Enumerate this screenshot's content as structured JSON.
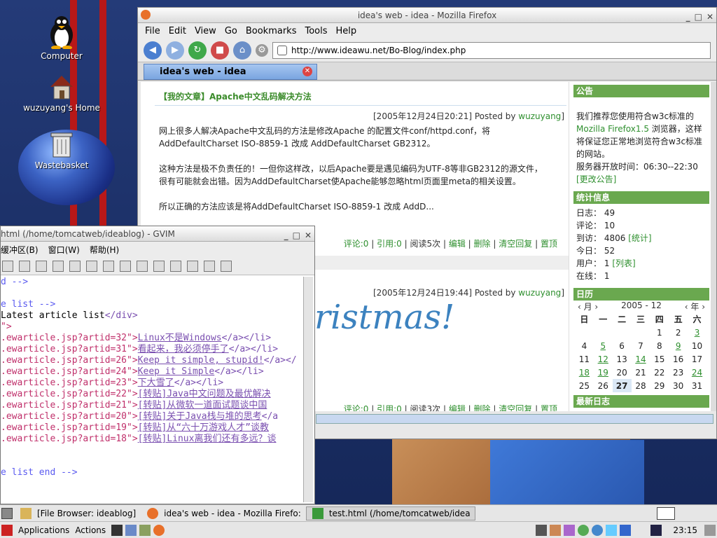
{
  "desktop": {
    "icons": [
      {
        "label": "Computer"
      },
      {
        "label": "wuzuyang's Home"
      },
      {
        "label": "Wastebasket"
      }
    ]
  },
  "firefox": {
    "title": "idea's web - idea - Mozilla Firefox",
    "menus": [
      "File",
      "Edit",
      "View",
      "Go",
      "Bookmarks",
      "Tools",
      "Help"
    ],
    "url": "http://www.ideawu.net/Bo-Blog/index.php",
    "tab_title": "idea's web - idea",
    "article1": {
      "title": "【我的文章】Apache中文乱码解决方法",
      "meta_prefix": "[2005年12月24日20:21]  Posted by ",
      "author": "wuzuyang",
      "meta_suffix": "]",
      "body": [
        "网上很多人解决Apache中文乱码的方法是修改Apache 的配置文件conf/httpd.conf，将",
        "AddDefaultCharset ISO-8859-1 改成 AddDefaultCharset GB2312。",
        "",
        "这种方法是极不负责任的！一但你这样改，以后Apache要是遇见编码为UTF-8等非GB2312的源文件，",
        "很有可能就会出错。因为AddDefaultCharset使Apache能够忽略html页面里meta的相关设置。",
        "",
        "所以正确的方法应该是将AddDefaultCharset ISO-8859-1 改成 AddD..."
      ],
      "footer": {
        "comments": "评论:0",
        "refs": "引用:0",
        "reads": "阅读5次",
        "edit": "编辑",
        "delete": "删除",
        "clear": "清空回复",
        "top": "置顶"
      }
    },
    "article2": {
      "meta_prefix": "[2005年12月24日19:44]  Posted by ",
      "author": "wuzuyang",
      "meta_suffix": "]",
      "image_text": "ristmas!",
      "footer": {
        "comments": "评论:0",
        "refs": "引用:0",
        "reads": "阅读3次",
        "edit": "编辑",
        "delete": "删除",
        "clear": "清空回复",
        "top": "置顶"
      }
    },
    "sidebar": {
      "notice_head": "公告",
      "notice_lines": [
        "我们推荐您使用符合w3c标准的",
        "Mozilla Firefox1.5",
        " 浏览器，这样",
        "将保证您正常地浏览符合w3c标准",
        "的网站。",
        "服务器开放时间：06:30--22:30",
        "[更改公告]"
      ],
      "stats_head": "统计信息",
      "stats": [
        {
          "k": "日志：",
          "v": "49",
          "link": ""
        },
        {
          "k": "评论：",
          "v": "10",
          "link": ""
        },
        {
          "k": "到访：",
          "v": "4806",
          "link": "[统计]"
        },
        {
          "k": "今日：",
          "v": "52",
          "link": ""
        },
        {
          "k": "用户：",
          "v": "1",
          "link": "[列表]"
        },
        {
          "k": "在线：",
          "v": "1",
          "link": ""
        }
      ],
      "cal_head": "日历",
      "cal_prev": "‹ 月 ›",
      "cal_month": "2005 - 12",
      "cal_year": "‹ 年 ›",
      "cal_days": [
        "日",
        "一",
        "二",
        "三",
        "四",
        "五",
        "六"
      ],
      "cal_rows": [
        [
          "",
          "",
          "",
          "",
          "1",
          "2",
          "3"
        ],
        [
          "4",
          "5",
          "6",
          "7",
          "8",
          "9",
          "10"
        ],
        [
          "11",
          "12",
          "13",
          "14",
          "15",
          "16",
          "17"
        ],
        [
          "18",
          "19",
          "20",
          "21",
          "22",
          "23",
          "24"
        ],
        [
          "25",
          "26",
          "27",
          "28",
          "29",
          "30",
          "31"
        ]
      ],
      "cal_links": [
        "3",
        "5",
        "9",
        "12",
        "14",
        "18",
        "19",
        "24"
      ],
      "cal_today": "27",
      "recent_head": "最新日志"
    }
  },
  "gvim": {
    "title": "html (/home/tomcatweb/ideablog) - GVIM",
    "menus": [
      "缓冲区(B)",
      "窗口(W)",
      "帮助(H)"
    ],
    "lines": [
      [
        {
          "t": "d -->",
          "c": "c-com"
        }
      ],
      [
        {
          "t": "",
          "c": ""
        }
      ],
      [
        {
          "t": "e list -->",
          "c": "c-com"
        }
      ],
      [
        {
          "t": "Latest article list",
          "c": ""
        },
        {
          "t": "</div>",
          "c": "c-tag"
        }
      ],
      [
        {
          "t": "\">",
          "c": "c-str"
        }
      ],
      [
        {
          "t": ".ewarticle.jsp?artid=32\">",
          "c": "c-str"
        },
        {
          "t": "Linux不是Windows",
          "c": "c-lnk"
        },
        {
          "t": "</a></li>",
          "c": "c-tag"
        }
      ],
      [
        {
          "t": ".ewarticle.jsp?artid=31\">",
          "c": "c-str"
        },
        {
          "t": "看起来，我必须停手了",
          "c": "c-lnk"
        },
        {
          "t": "</a></li>",
          "c": "c-tag"
        }
      ],
      [
        {
          "t": ".ewarticle.jsp?artid=26\">",
          "c": "c-str"
        },
        {
          "t": "Keep it simple, stupid!",
          "c": "c-lnk"
        },
        {
          "t": "</a></",
          "c": "c-tag"
        }
      ],
      [
        {
          "t": ".ewarticle.jsp?artid=24\">",
          "c": "c-str"
        },
        {
          "t": "Keep it Simple",
          "c": "c-lnk"
        },
        {
          "t": "</a></li>",
          "c": "c-tag"
        }
      ],
      [
        {
          "t": ".ewarticle.jsp?artid=23\">",
          "c": "c-str"
        },
        {
          "t": "下大雪了",
          "c": "c-lnk"
        },
        {
          "t": "</a></li>",
          "c": "c-tag"
        }
      ],
      [
        {
          "t": ".ewarticle.jsp?artid=22\">",
          "c": "c-str"
        },
        {
          "t": "[转贴]Java中文问题及最优解决",
          "c": "c-lnk"
        }
      ],
      [
        {
          "t": ".ewarticle.jsp?artid=21\">",
          "c": "c-str"
        },
        {
          "t": "[转贴]从微软一道面试题谈中国",
          "c": "c-lnk"
        }
      ],
      [
        {
          "t": ".ewarticle.jsp?artid=20\">",
          "c": "c-str"
        },
        {
          "t": "[转贴]关于Java栈与堆的思考",
          "c": "c-lnk"
        },
        {
          "t": "</a",
          "c": "c-tag"
        }
      ],
      [
        {
          "t": ".ewarticle.jsp?artid=19\">",
          "c": "c-str"
        },
        {
          "t": "[转贴]从“六十万游戏人才”谈教",
          "c": "c-lnk"
        }
      ],
      [
        {
          "t": ".ewarticle.jsp?artid=18\">",
          "c": "c-str"
        },
        {
          "t": "[转贴]Linux离我们还有多远？谈",
          "c": "c-lnk"
        }
      ],
      [
        {
          "t": "",
          "c": ""
        }
      ],
      [
        {
          "t": "",
          "c": ""
        }
      ],
      [
        {
          "t": "e list end -->",
          "c": "c-com"
        }
      ],
      [
        {
          "t": "",
          "c": ""
        }
      ],
      [
        {
          "t": "",
          "c": ""
        }
      ],
      [
        {
          "t": ">",
          "c": "c-str"
        }
      ]
    ]
  },
  "taskbar": {
    "tasks": [
      {
        "label": "[File Browser: ideablog]"
      },
      {
        "label": "idea's web - idea - Mozilla Firefo:"
      },
      {
        "label": "test.html (/home/tomcatweb/idea"
      }
    ]
  },
  "panel": {
    "applications": "Applications",
    "actions": "Actions",
    "clock": "23:15"
  }
}
